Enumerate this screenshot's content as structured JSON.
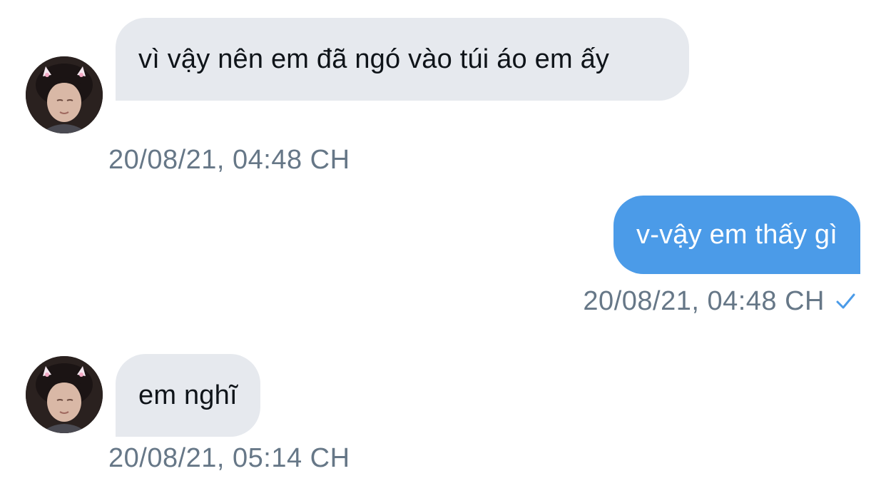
{
  "messages": [
    {
      "direction": "incoming",
      "text": "vì vậy nên em đã ngó vào túi áo em ấy",
      "timestamp": "20/08/21, 04:48 CH"
    },
    {
      "direction": "outgoing",
      "text": "v-vậy em thấy gì",
      "timestamp": "20/08/21, 04:48 CH",
      "status_icon": "check-icon"
    },
    {
      "direction": "incoming",
      "text": "em nghĩ",
      "timestamp": "20/08/21, 05:14 CH"
    }
  ],
  "colors": {
    "incoming_bubble": "#e6e9ee",
    "outgoing_bubble": "#4b9be8",
    "timestamp": "#667787",
    "check": "#4b9be8"
  }
}
